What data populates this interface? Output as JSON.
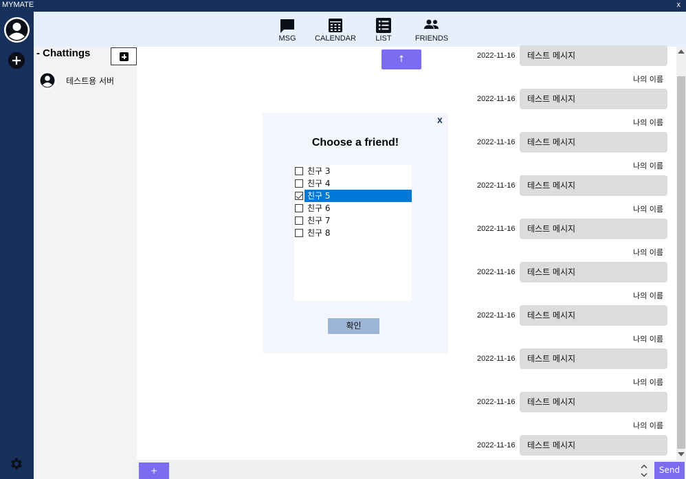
{
  "window": {
    "title": "MYMATE",
    "close_label": "x"
  },
  "nav": [
    {
      "label": "MSG",
      "icon": "chat-bubble-icon"
    },
    {
      "label": "CALENDAR",
      "icon": "calendar-icon"
    },
    {
      "label": "LIST",
      "icon": "list-icon"
    },
    {
      "label": "FRIENDS",
      "icon": "friends-icon"
    }
  ],
  "sidebar": {
    "header": "- Chattings",
    "servers": [
      {
        "name": "테스트용 서버"
      }
    ]
  },
  "main": {
    "scroll_up_label": "↑"
  },
  "messages": [
    {
      "date": "2022-11-16",
      "sender": "",
      "text": "테스트 메시지"
    },
    {
      "date": "2022-11-16",
      "sender": "나의 이름",
      "text": "테스트 메시지"
    },
    {
      "date": "2022-11-16",
      "sender": "나의 이름",
      "text": "테스트 메시지"
    },
    {
      "date": "2022-11-16",
      "sender": "나의 이름",
      "text": "테스트 메시지"
    },
    {
      "date": "2022-11-16",
      "sender": "나의 이름",
      "text": "테스트 메시지"
    },
    {
      "date": "2022-11-16",
      "sender": "나의 이름",
      "text": "테스트 메시지"
    },
    {
      "date": "2022-11-16",
      "sender": "나의 이름",
      "text": "테스트 메시지"
    },
    {
      "date": "2022-11-16",
      "sender": "나의 이름",
      "text": "테스트 메시지"
    },
    {
      "date": "2022-11-16",
      "sender": "나의 이름",
      "text": "테스트 메시지"
    },
    {
      "date": "2022-11-16",
      "sender": "나의 이름",
      "text": "테스트 메시지"
    }
  ],
  "composer": {
    "attach_label": "+",
    "input_value": "",
    "send_label": "Send"
  },
  "modal": {
    "close_label": "x",
    "title": "Choose a friend!",
    "friends": [
      {
        "name": "친구 3",
        "checked": false,
        "selected": false
      },
      {
        "name": "친구 4",
        "checked": false,
        "selected": false
      },
      {
        "name": "친구 5",
        "checked": true,
        "selected": true
      },
      {
        "name": "친구 6",
        "checked": false,
        "selected": false
      },
      {
        "name": "친구 7",
        "checked": false,
        "selected": false
      },
      {
        "name": "친구 8",
        "checked": false,
        "selected": false
      }
    ],
    "confirm_label": "확인"
  },
  "colors": {
    "navy": "#17305c",
    "accent": "#7b6cf0",
    "nav_bg": "#e6f0fc",
    "bubble": "#dcdcdc",
    "selection": "#0078d7",
    "confirm": "#9cb5d4"
  }
}
